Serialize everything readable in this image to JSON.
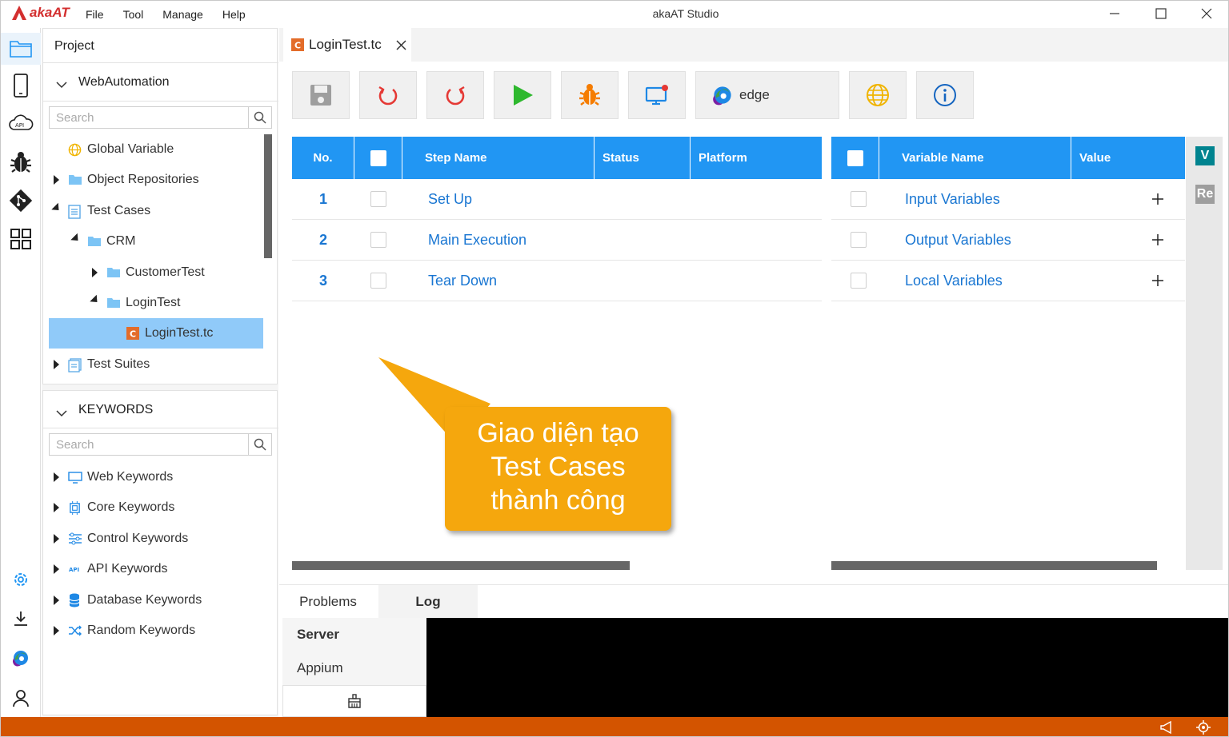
{
  "titlebar": {
    "logo_text": "akaAT",
    "window_title": "akaAT Studio",
    "menu": [
      "File",
      "Tool",
      "Manage",
      "Help"
    ],
    "controls": [
      "minimize-icon",
      "maximize-icon",
      "close-icon"
    ]
  },
  "activity_bar": {
    "top": [
      "folder-icon",
      "mobile-icon",
      "api-cloud-icon",
      "bug-icon",
      "git-icon",
      "grid-icon"
    ],
    "bottom": [
      "gear-icon",
      "download-icon",
      "edge-icon",
      "user-icon"
    ]
  },
  "project_panel": {
    "title": "Project",
    "project_name": "WebAutomation",
    "search_placeholder": "Search",
    "tree": [
      {
        "label": "Global Variable"
      },
      {
        "label": "Object Repositories"
      },
      {
        "label": "Test Cases"
      },
      {
        "label": "CRM"
      },
      {
        "label": "CustomerTest"
      },
      {
        "label": "LoginTest"
      },
      {
        "label": "LoginTest.tc",
        "selected": true
      },
      {
        "label": "Test Suites"
      }
    ]
  },
  "keywords_panel": {
    "title": "KEYWORDS",
    "search_placeholder": "Search",
    "items": [
      {
        "label": "Web Keywords"
      },
      {
        "label": "Core Keywords"
      },
      {
        "label": "Control Keywords"
      },
      {
        "label": "API Keywords"
      },
      {
        "label": "Database Keywords"
      },
      {
        "label": "Random Keywords"
      }
    ]
  },
  "editor": {
    "tab_label": "LoginTest.tc",
    "toolbar": [
      "save-icon",
      "undo-icon",
      "redo-icon",
      "run-icon",
      "debug-icon",
      "device-icon",
      "edge-icon",
      "globe-icon",
      "info-icon"
    ],
    "browser_label": "edge",
    "steps_table": {
      "columns": [
        "No.",
        "",
        "Step Name",
        "Status",
        "Platform"
      ],
      "rows": [
        {
          "no": "1",
          "name": "Set Up"
        },
        {
          "no": "2",
          "name": "Main Execution"
        },
        {
          "no": "3",
          "name": "Tear Down"
        }
      ]
    },
    "variables_table": {
      "columns": [
        "",
        "Variable Name",
        "Value"
      ],
      "rows": [
        {
          "name": "Input Variables"
        },
        {
          "name": "Output Variables"
        },
        {
          "name": "Local Variables"
        }
      ]
    },
    "side_tabs": [
      "V",
      "Re"
    ]
  },
  "bottom_panel": {
    "tabs": [
      "Problems",
      "Log"
    ],
    "active_tab": "Log",
    "servers": [
      "Server",
      "Appium"
    ]
  },
  "callout": {
    "lines": [
      "Giao diện tạo",
      "Test Cases",
      "thành công"
    ]
  },
  "colors": {
    "accent": "#2196f3",
    "selection": "#90caf9",
    "status_bar": "#d35400",
    "callout": "#f5a70d"
  }
}
